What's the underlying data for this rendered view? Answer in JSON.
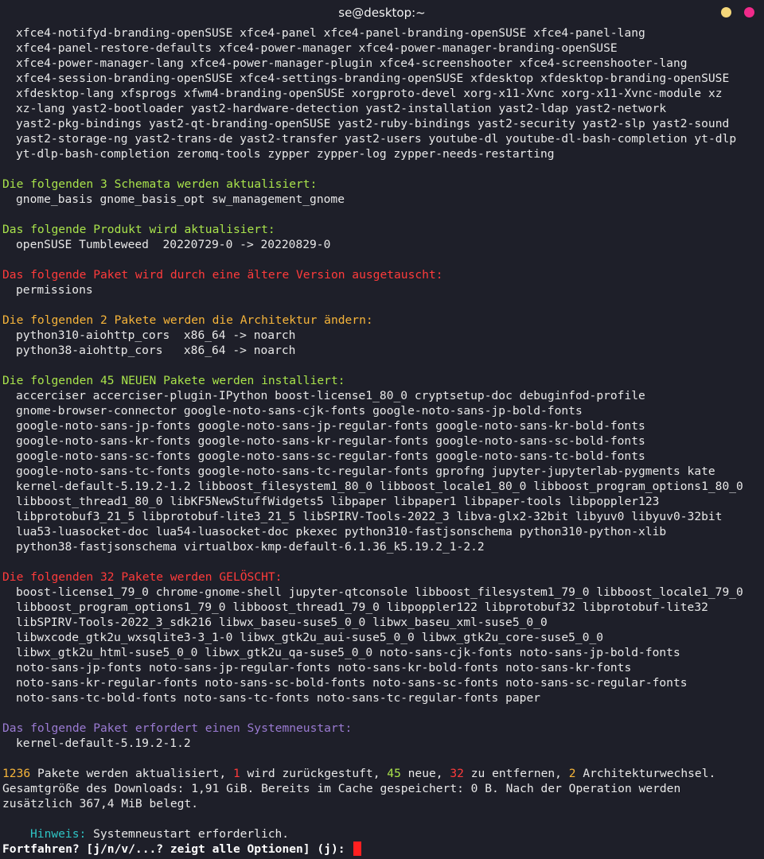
{
  "window": {
    "title": "se@desktop:~"
  },
  "top_block": [
    [
      "xfce4-notifyd-branding-openSUSE",
      "xfce4-panel",
      "xfce4-panel-branding-openSUSE",
      "xfce4-panel-lang"
    ],
    [
      "xfce4-panel-restore-defaults",
      "xfce4-power-manager",
      "xfce4-power-manager-branding-openSUSE"
    ],
    [
      "xfce4-power-manager-lang",
      "xfce4-power-manager-plugin",
      "xfce4-screenshooter",
      "xfce4-screenshooter-lang"
    ],
    [
      "xfce4-session-branding-openSUSE",
      "xfce4-settings-branding-openSUSE",
      "xfdesktop",
      "xfdesktop-branding-openSUSE"
    ],
    [
      "xfdesktop-lang",
      "xfsprogs",
      "xfwm4-branding-openSUSE",
      "xorgproto-devel",
      "xorg-x11-Xvnc",
      "xorg-x11-Xvnc-module",
      "xz"
    ],
    [
      "xz-lang",
      "yast2-bootloader",
      "yast2-hardware-detection",
      "yast2-installation",
      "yast2-ldap",
      "yast2-network"
    ],
    [
      "yast2-pkg-bindings",
      "yast2-qt-branding-openSUSE",
      "yast2-ruby-bindings",
      "yast2-security",
      "yast2-slp",
      "yast2-sound"
    ],
    [
      "yast2-storage-ng",
      "yast2-trans-de",
      "yast2-transfer",
      "yast2-users",
      "youtube-dl",
      "youtube-dl-bash-completion",
      "yt-dlp"
    ],
    [
      "yt-dlp-bash-completion",
      "zeromq-tools",
      "zypper",
      "zypper-log",
      "zypper-needs-restarting"
    ]
  ],
  "schemata": {
    "header": "Die folgenden 3 Schemata werden aktualisiert:",
    "lines": [
      [
        "gnome_basis",
        "gnome_basis_opt",
        "sw_management_gnome"
      ]
    ]
  },
  "product": {
    "header": "Das folgende Produkt wird aktualisiert:",
    "lines": [
      "openSUSE Tumbleweed  20220729-0 -> 20220829-0"
    ]
  },
  "downgrade": {
    "header": "Das folgende Paket wird durch eine ältere Version ausgetauscht:",
    "lines": [
      [
        "permissions"
      ]
    ]
  },
  "arch": {
    "header": "Die folgenden 2 Pakete werden die Architektur ändern:",
    "lines": [
      "python310-aiohttp_cors  x86_64 -> noarch",
      "python38-aiohttp_cors   x86_64 -> noarch"
    ]
  },
  "new_packages": {
    "header": "Die folgenden 45 NEUEN Pakete werden installiert:",
    "lines": [
      [
        "accerciser",
        "accerciser-plugin-IPython",
        "boost-license1_80_0",
        "cryptsetup-doc",
        "debuginfod-profile"
      ],
      [
        "gnome-browser-connector",
        "google-noto-sans-cjk-fonts",
        "google-noto-sans-jp-bold-fonts"
      ],
      [
        "google-noto-sans-jp-fonts",
        "google-noto-sans-jp-regular-fonts",
        "google-noto-sans-kr-bold-fonts"
      ],
      [
        "google-noto-sans-kr-fonts",
        "google-noto-sans-kr-regular-fonts",
        "google-noto-sans-sc-bold-fonts"
      ],
      [
        "google-noto-sans-sc-fonts",
        "google-noto-sans-sc-regular-fonts",
        "google-noto-sans-tc-bold-fonts"
      ],
      [
        "google-noto-sans-tc-fonts",
        "google-noto-sans-tc-regular-fonts",
        "gprofng",
        "jupyter-jupyterlab-pygments",
        "kate"
      ],
      [
        "kernel-default-5.19.2-1.2",
        "libboost_filesystem1_80_0",
        "libboost_locale1_80_0",
        "libboost_program_options1_80_0"
      ],
      [
        "libboost_thread1_80_0",
        "libKF5NewStuffWidgets5",
        "libpaper",
        "libpaper1",
        "libpaper-tools",
        "libpoppler123"
      ],
      [
        "libprotobuf3_21_5",
        "libprotobuf-lite3_21_5",
        "libSPIRV-Tools-2022_3",
        "libva-glx2-32bit",
        "libyuv0",
        "libyuv0-32bit"
      ],
      [
        "lua53-luasocket-doc",
        "lua54-luasocket-doc",
        "pkexec",
        "python310-fastjsonschema",
        "python310-python-xlib"
      ],
      [
        "python38-fastjsonschema",
        "virtualbox-kmp-default-6.1.36_k5.19.2_1-2.2"
      ]
    ]
  },
  "removed_packages": {
    "header": "Die folgenden 32 Pakete werden GELÖSCHT:",
    "lines": [
      [
        "boost-license1_79_0",
        "chrome-gnome-shell",
        "jupyter-qtconsole",
        "libboost_filesystem1_79_0",
        "libboost_locale1_79_0"
      ],
      [
        "libboost_program_options1_79_0",
        "libboost_thread1_79_0",
        "libpoppler122",
        "libprotobuf32",
        "libprotobuf-lite32"
      ],
      [
        "libSPIRV-Tools-2022_3_sdk216",
        "libwx_baseu-suse5_0_0",
        "libwx_baseu_xml-suse5_0_0"
      ],
      [
        "libwxcode_gtk2u_wxsqlite3-3_1-0",
        "libwx_gtk2u_aui-suse5_0_0",
        "libwx_gtk2u_core-suse5_0_0"
      ],
      [
        "libwx_gtk2u_html-suse5_0_0",
        "libwx_gtk2u_qa-suse5_0_0",
        "noto-sans-cjk-fonts",
        "noto-sans-jp-bold-fonts"
      ],
      [
        "noto-sans-jp-fonts",
        "noto-sans-jp-regular-fonts",
        "noto-sans-kr-bold-fonts",
        "noto-sans-kr-fonts"
      ],
      [
        "noto-sans-kr-regular-fonts",
        "noto-sans-sc-bold-fonts",
        "noto-sans-sc-fonts",
        "noto-sans-sc-regular-fonts"
      ],
      [
        "noto-sans-tc-bold-fonts",
        "noto-sans-tc-fonts",
        "noto-sans-tc-regular-fonts",
        "paper"
      ]
    ]
  },
  "restart": {
    "header": "Das folgende Paket erfordert einen Systemneustart:",
    "lines": [
      [
        "kernel-default-5.19.2-1.2"
      ]
    ]
  },
  "summary": {
    "count_upgrade": "1236",
    "text_upgrade": " Pakete werden aktualisiert, ",
    "count_downgrade": "1",
    "text_downgrade": " wird zurückgestuft, ",
    "count_new": "45",
    "text_new": " neue, ",
    "count_remove": "32",
    "text_remove": " zu entfernen, ",
    "count_arch": "2",
    "text_arch": " Architekturwechsel.",
    "line2": "Gesamtgröße des Downloads: 1,91 GiB. Bereits im Cache gespeichert: 0 B. Nach der Operation werden",
    "line3": "zusätzlich 367,4 MiB belegt."
  },
  "hint": {
    "label": "Hinweis:",
    "text": " Systemneustart erforderlich."
  },
  "prompt": {
    "text": "Fortfahren? [j/n/v/...? zeigt alle Optionen] (j): "
  }
}
